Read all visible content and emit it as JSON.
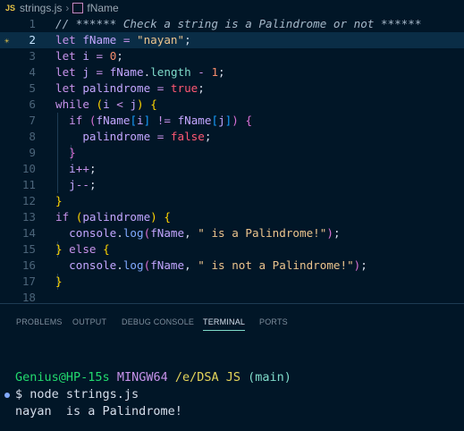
{
  "breadcrumb": {
    "lang_badge": "JS",
    "file": "strings.js",
    "symbol": "fName"
  },
  "editor": {
    "lines": [
      {
        "n": "1",
        "tokens": [
          [
            "cm",
            "// ****** Check a string is a Palindrome or not ******"
          ]
        ]
      },
      {
        "n": "2",
        "highlight": true,
        "tokens": [
          [
            "kw",
            "let "
          ],
          [
            "var",
            "fName"
          ],
          [
            "op",
            " = "
          ],
          [
            "str",
            "\"nayan\""
          ],
          [
            "punct",
            ";"
          ]
        ]
      },
      {
        "n": "3",
        "tokens": [
          [
            "kw",
            "let "
          ],
          [
            "var",
            "i"
          ],
          [
            "op",
            " = "
          ],
          [
            "num",
            "0"
          ],
          [
            "punct",
            ";"
          ]
        ]
      },
      {
        "n": "4",
        "tokens": [
          [
            "kw",
            "let "
          ],
          [
            "var",
            "j"
          ],
          [
            "op",
            " = "
          ],
          [
            "var",
            "fName"
          ],
          [
            "punct",
            "."
          ],
          [
            "prop",
            "length"
          ],
          [
            "op",
            " - "
          ],
          [
            "num",
            "1"
          ],
          [
            "punct",
            ";"
          ]
        ]
      },
      {
        "n": "5",
        "tokens": [
          [
            "kw",
            "let "
          ],
          [
            "var",
            "palindrome"
          ],
          [
            "op",
            " = "
          ],
          [
            "bool",
            "true"
          ],
          [
            "punct",
            ";"
          ]
        ]
      },
      {
        "n": "6",
        "tokens": [
          [
            "kw",
            "while "
          ],
          [
            "pr1",
            "("
          ],
          [
            "var",
            "i"
          ],
          [
            "op",
            " < "
          ],
          [
            "var",
            "j"
          ],
          [
            "pr1",
            ")"
          ],
          [
            "punct",
            " "
          ],
          [
            "pr1",
            "{"
          ]
        ]
      },
      {
        "n": "7",
        "tokens": [
          [
            "punct",
            "  "
          ],
          [
            "kw",
            "if "
          ],
          [
            "pr2",
            "("
          ],
          [
            "var",
            "fName"
          ],
          [
            "pr3",
            "["
          ],
          [
            "var",
            "i"
          ],
          [
            "pr3",
            "]"
          ],
          [
            "op",
            " != "
          ],
          [
            "var",
            "fName"
          ],
          [
            "pr3",
            "["
          ],
          [
            "var",
            "j"
          ],
          [
            "pr3",
            "]"
          ],
          [
            "pr2",
            ")"
          ],
          [
            "punct",
            " "
          ],
          [
            "pr2",
            "{"
          ]
        ]
      },
      {
        "n": "8",
        "tokens": [
          [
            "punct",
            "    "
          ],
          [
            "var",
            "palindrome"
          ],
          [
            "op",
            " = "
          ],
          [
            "bool",
            "false"
          ],
          [
            "punct",
            ";"
          ]
        ]
      },
      {
        "n": "9",
        "tokens": [
          [
            "punct",
            "  "
          ],
          [
            "pr2",
            "}"
          ]
        ]
      },
      {
        "n": "10",
        "tokens": [
          [
            "punct",
            "  "
          ],
          [
            "var",
            "i"
          ],
          [
            "op",
            "++"
          ],
          [
            "punct",
            ";"
          ]
        ]
      },
      {
        "n": "11",
        "tokens": [
          [
            "punct",
            "  "
          ],
          [
            "var",
            "j"
          ],
          [
            "op",
            "--"
          ],
          [
            "punct",
            ";"
          ]
        ]
      },
      {
        "n": "12",
        "tokens": [
          [
            "pr1",
            "}"
          ]
        ]
      },
      {
        "n": "13",
        "tokens": [
          [
            "kw",
            "if "
          ],
          [
            "pr1",
            "("
          ],
          [
            "var",
            "palindrome"
          ],
          [
            "pr1",
            ")"
          ],
          [
            "punct",
            " "
          ],
          [
            "pr1",
            "{"
          ]
        ]
      },
      {
        "n": "14",
        "tokens": [
          [
            "punct",
            "  "
          ],
          [
            "var",
            "console"
          ],
          [
            "punct",
            "."
          ],
          [
            "fn",
            "log"
          ],
          [
            "pr2",
            "("
          ],
          [
            "var",
            "fName"
          ],
          [
            "punct",
            ", "
          ],
          [
            "str",
            "\" is a Palindrome!\""
          ],
          [
            "pr2",
            ")"
          ],
          [
            "punct",
            ";"
          ]
        ]
      },
      {
        "n": "15",
        "tokens": [
          [
            "pr1",
            "}"
          ],
          [
            "kw",
            " else "
          ],
          [
            "pr1",
            "{"
          ]
        ]
      },
      {
        "n": "16",
        "tokens": [
          [
            "punct",
            "  "
          ],
          [
            "var",
            "console"
          ],
          [
            "punct",
            "."
          ],
          [
            "fn",
            "log"
          ],
          [
            "pr2",
            "("
          ],
          [
            "var",
            "fName"
          ],
          [
            "punct",
            ", "
          ],
          [
            "str",
            "\" is not a Palindrome!\""
          ],
          [
            "pr2",
            ")"
          ],
          [
            "punct",
            ";"
          ]
        ]
      },
      {
        "n": "17",
        "tokens": [
          [
            "pr1",
            "}"
          ]
        ]
      },
      {
        "n": "18",
        "tokens": []
      }
    ]
  },
  "panel": {
    "tabs": [
      {
        "label": "PROBLEMS",
        "active": false
      },
      {
        "label": "OUTPUT",
        "active": false
      },
      {
        "label": "DEBUG CONSOLE",
        "active": false
      },
      {
        "label": "TERMINAL",
        "active": true
      },
      {
        "label": "PORTS",
        "active": false
      }
    ]
  },
  "terminal": {
    "prompt_user": "Genius@HP-15s",
    "prompt_shell": "MINGW64",
    "prompt_path": "/e/DSA JS",
    "prompt_branch": "(main)",
    "command": "$ node strings.js",
    "output": "nayan  is a Palindrome!"
  },
  "colors": {
    "background": "#011627",
    "line_highlight": "#0a2d46",
    "active_tab_underline": "#7fdbca"
  }
}
